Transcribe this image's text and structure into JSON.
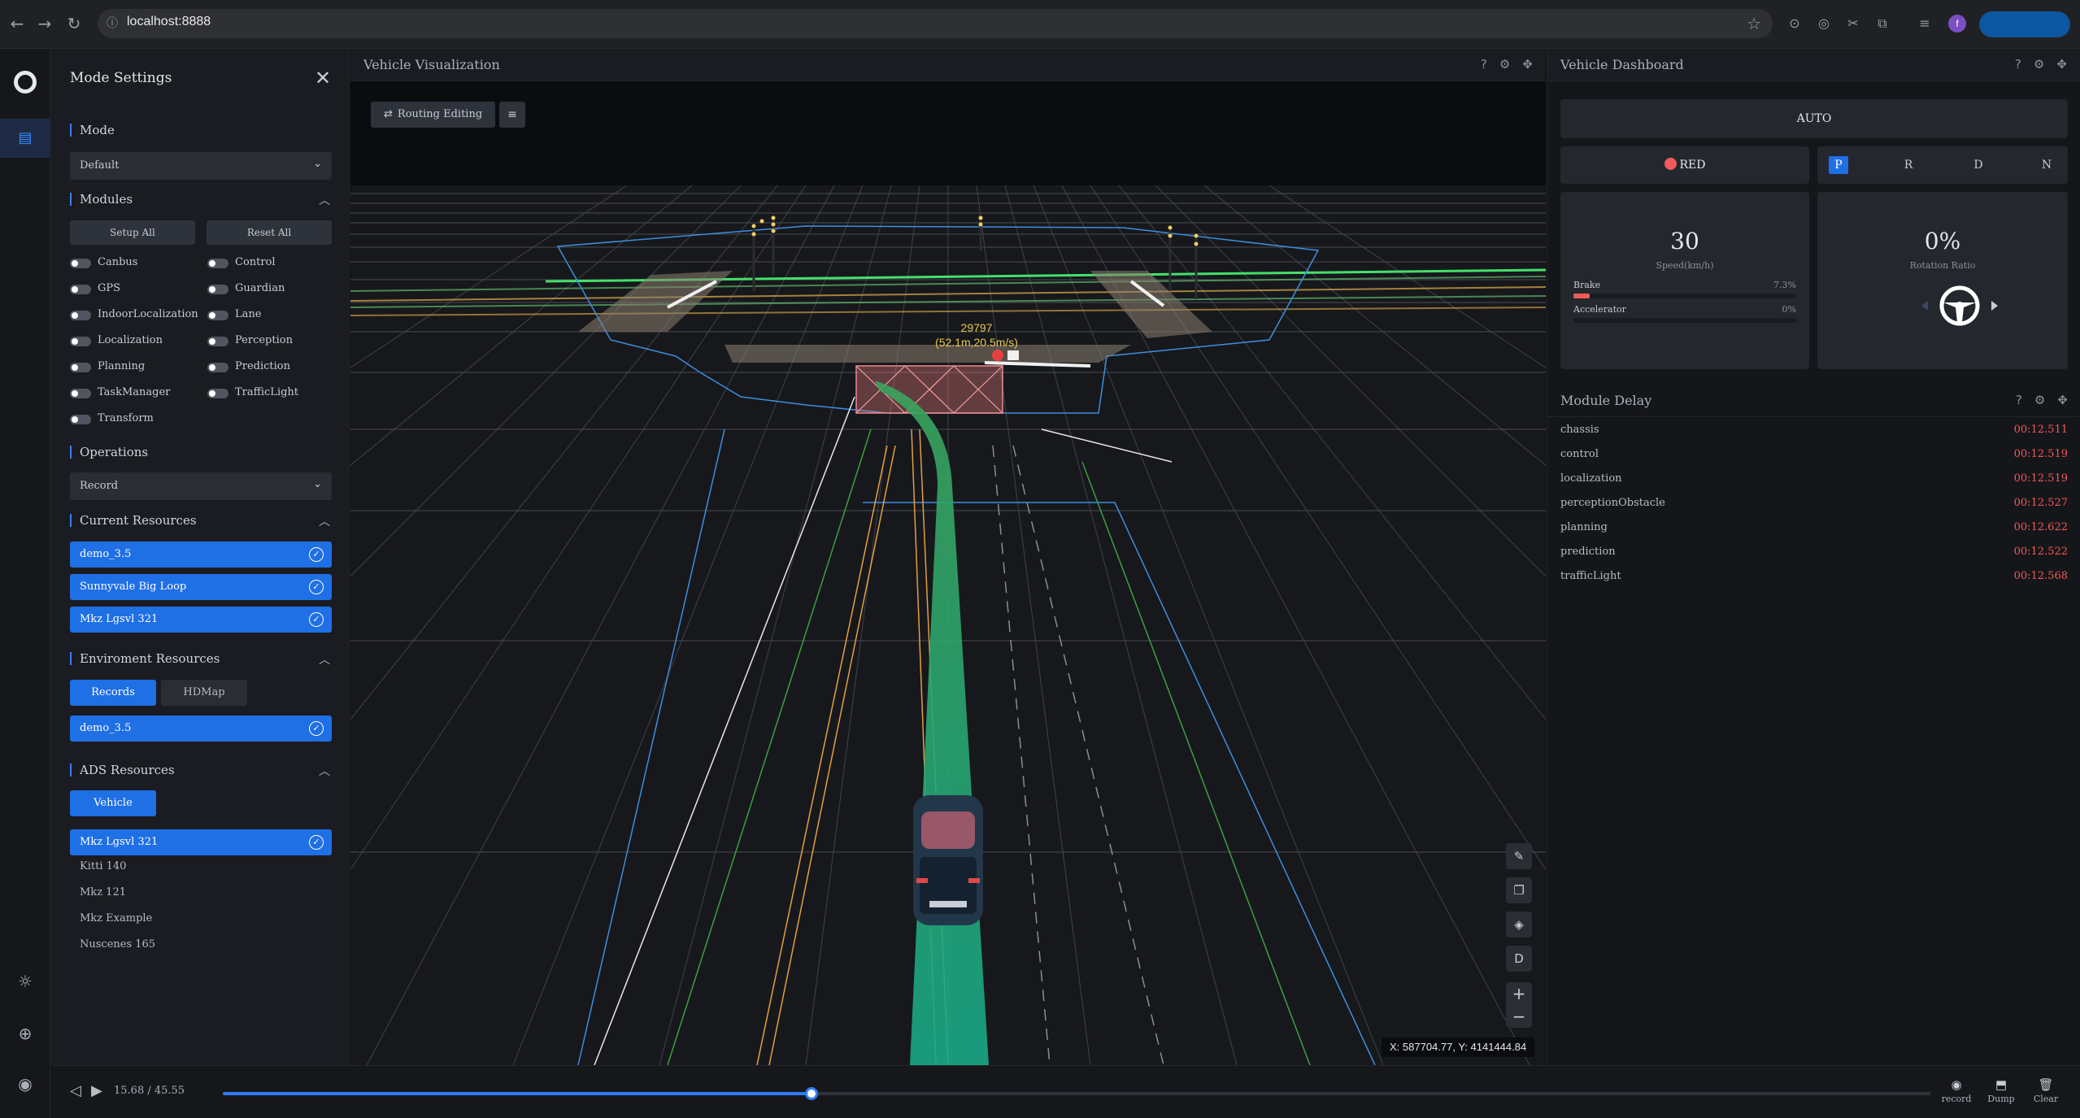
{
  "browser": {
    "url": "localhost:8888",
    "profile_initial": "f"
  },
  "rail": {
    "items": [
      "logo-icon",
      "list-icon",
      "sun-icon",
      "crosshair-icon",
      "user-icon"
    ]
  },
  "settings": {
    "title": "Mode Settings",
    "mode": {
      "title": "Mode",
      "value": "Default"
    },
    "modules": {
      "title": "Modules",
      "setup_all": "Setup All",
      "reset_all": "Reset All",
      "left": [
        "Canbus",
        "GPS",
        "IndoorLocalization",
        "Localization",
        "Planning",
        "TaskManager",
        "Transform"
      ],
      "right": [
        "Control",
        "Guardian",
        "Lane",
        "Perception",
        "Prediction",
        "TrafficLight"
      ]
    },
    "operations": {
      "title": "Operations",
      "value": "Record"
    },
    "current_resources": {
      "title": "Current Resources",
      "items": [
        "demo_3.5",
        "Sunnyvale Big Loop",
        "Mkz Lgsvl 321"
      ]
    },
    "env_resources": {
      "title": "Enviroment Resources",
      "tabs": [
        "Records",
        "HDMap"
      ],
      "items": [
        "demo_3.5"
      ]
    },
    "ads_resources": {
      "title": "ADS Resources",
      "tab": "Vehicle",
      "selected": "Mkz Lgsvl 321",
      "items": [
        "Kitti 140",
        "Mkz 121",
        "Mkz Example",
        "Nuscenes 165"
      ]
    }
  },
  "player": {
    "time": "15.68 / 45.55",
    "progress": 0.3447,
    "actions": [
      "record",
      "Dump",
      "Clear"
    ]
  },
  "viz": {
    "title": "Vehicle Visualization",
    "routing_label": "Routing Editing",
    "obstacle_id": "29797",
    "obstacle_info": "(52.1m,20.5m/s)",
    "coords": "X: 587704.77, Y: 4141444.84",
    "tools": [
      "ruler-icon",
      "copy-icon",
      "layers-icon",
      "D"
    ]
  },
  "dash": {
    "title": "Vehicle Dashboard",
    "mode": "AUTO",
    "light": "RED",
    "gears": [
      "P",
      "R",
      "D",
      "N"
    ],
    "active_gear": "P",
    "speed": "30",
    "speed_unit": "Speed(km/h)",
    "brake_label": "Brake",
    "brake_value": "7.3%",
    "brake_fraction": 0.073,
    "accel_label": "Accelerator",
    "accel_value": "0%",
    "accel_fraction": 0,
    "rotation": "0%",
    "rotation_label": "Rotation Ratio"
  },
  "delay": {
    "title": "Module Delay",
    "rows": [
      {
        "name": "chassis",
        "value": "00:12.511"
      },
      {
        "name": "control",
        "value": "00:12.519"
      },
      {
        "name": "localization",
        "value": "00:12.519"
      },
      {
        "name": "perceptionObstacle",
        "value": "00:12.527"
      },
      {
        "name": "planning",
        "value": "00:12.622"
      },
      {
        "name": "prediction",
        "value": "00:12.522"
      },
      {
        "name": "trafficLight",
        "value": "00:12.568"
      }
    ]
  }
}
